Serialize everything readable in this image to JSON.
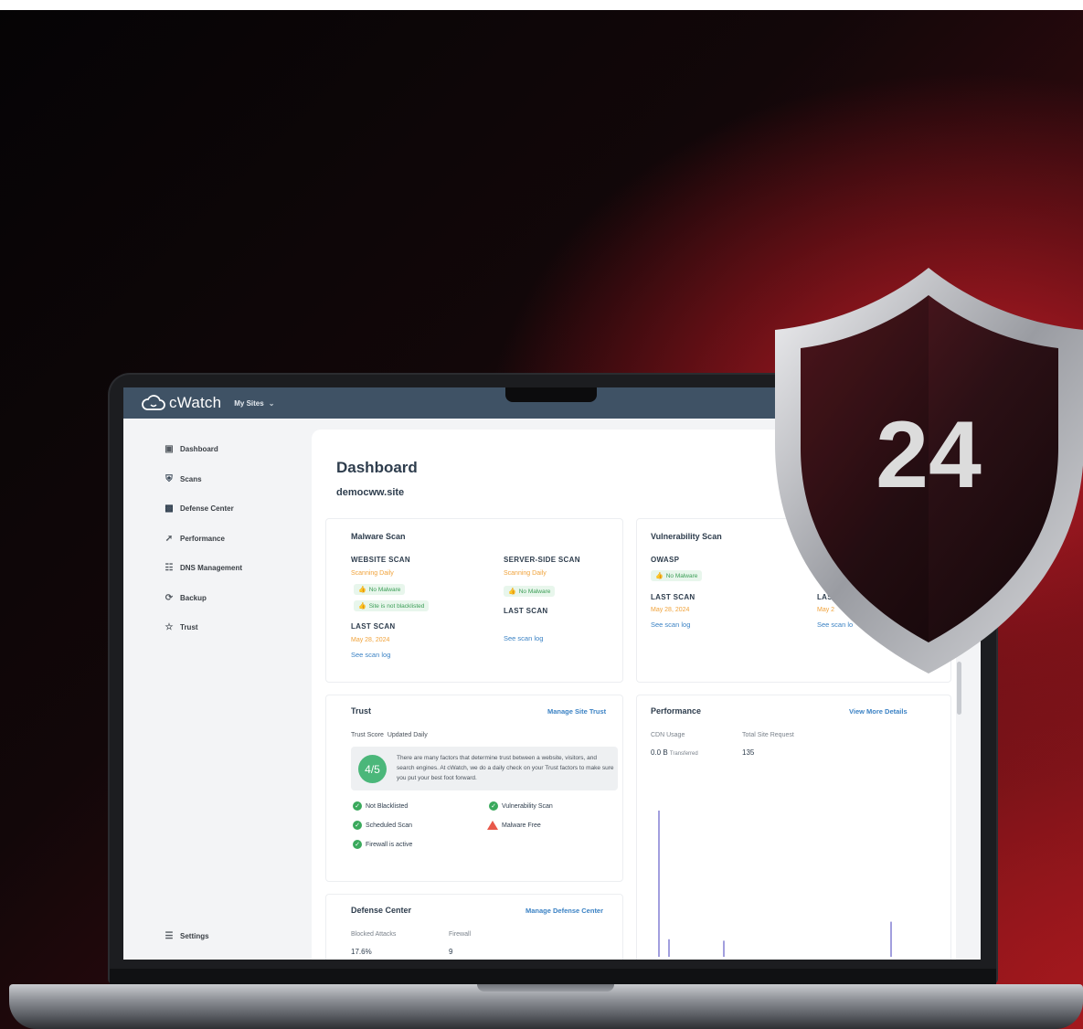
{
  "app": {
    "logo_text": "cWatch",
    "site_selector": "My Sites"
  },
  "sidebar": {
    "items": [
      {
        "label": "Dashboard",
        "icon": "dashboard-icon"
      },
      {
        "label": "Scans",
        "icon": "shield-icon"
      },
      {
        "label": "Defense Center",
        "icon": "defense-icon"
      },
      {
        "label": "Performance",
        "icon": "rocket-icon"
      },
      {
        "label": "DNS Management",
        "icon": "dns-icon"
      },
      {
        "label": "Backup",
        "icon": "backup-icon"
      },
      {
        "label": "Trust",
        "icon": "trust-icon"
      }
    ],
    "settings_label": "Settings"
  },
  "main": {
    "title": "Dashboard",
    "site": "democww.site",
    "malware": {
      "title": "Malware Scan",
      "website_scan": "WEBSITE SCAN",
      "website_freq": "Scanning Daily",
      "no_malware": "No Malware",
      "not_blacklisted": "Site is not blacklisted",
      "website_last_scan": "LAST SCAN",
      "website_last_date": "May 28, 2024",
      "see_log": "See scan log",
      "server_scan": "SERVER-SIDE SCAN",
      "server_freq": "Scanning Daily",
      "server_no_malware": "No Malware",
      "server_last_scan": "LAST SCAN",
      "server_see_log": "See scan log"
    },
    "vulnerability": {
      "title": "Vulnerability Scan",
      "owasp": "OWASP",
      "no_malware": "No Malware",
      "last_scan": "LAST SCAN",
      "last_date": "May 28, 2024",
      "see_log": "See scan log",
      "last_scan_2": "LAS",
      "last_date_2": "May 2",
      "see_log_2": "See scan lo"
    },
    "trust": {
      "title": "Trust",
      "manage_link": "Manage Site Trust",
      "score_label": "Trust Score",
      "updated": "Updated Daily",
      "score": "4/5",
      "description": "There are many factors that determine trust between a website, visitors, and search engines. At cWatch, we do a daily check on your Trust factors to make sure you put your best foot forward.",
      "checks": [
        {
          "label": "Not Blacklisted",
          "status": "ok"
        },
        {
          "label": "Vulnerability Scan",
          "status": "ok"
        },
        {
          "label": "Scheduled Scan",
          "status": "ok"
        },
        {
          "label": "Malware Free",
          "status": "warning"
        },
        {
          "label": "Firewall is active",
          "status": "ok"
        }
      ]
    },
    "performance": {
      "title": "Performance",
      "details_link": "View More Details",
      "cdn_label": "CDN Usage",
      "requests_label": "Total Site Request",
      "cdn_value": "0.0 B",
      "cdn_unit": "Transferred",
      "requests_value": "135"
    },
    "defense": {
      "title": "Defense Center",
      "manage_link": "Manage Defense Center",
      "blocked_label": "Blocked Attacks",
      "firewall_label": "Firewall",
      "blocked_value": "17.6%",
      "firewall_value": "9"
    }
  },
  "badge": {
    "number": "24"
  },
  "colors": {
    "header": "#3f5265",
    "accent_link": "#3b82c4",
    "warning_text": "#f0a23a",
    "success": "#3aa95c",
    "chart_line": "#8a87d6"
  },
  "chart_data": {
    "type": "bar",
    "title": "",
    "xlabel": "",
    "ylabel": "",
    "series": [
      {
        "values": [
          1.0,
          0.12,
          0.11,
          0.24
        ]
      }
    ]
  }
}
